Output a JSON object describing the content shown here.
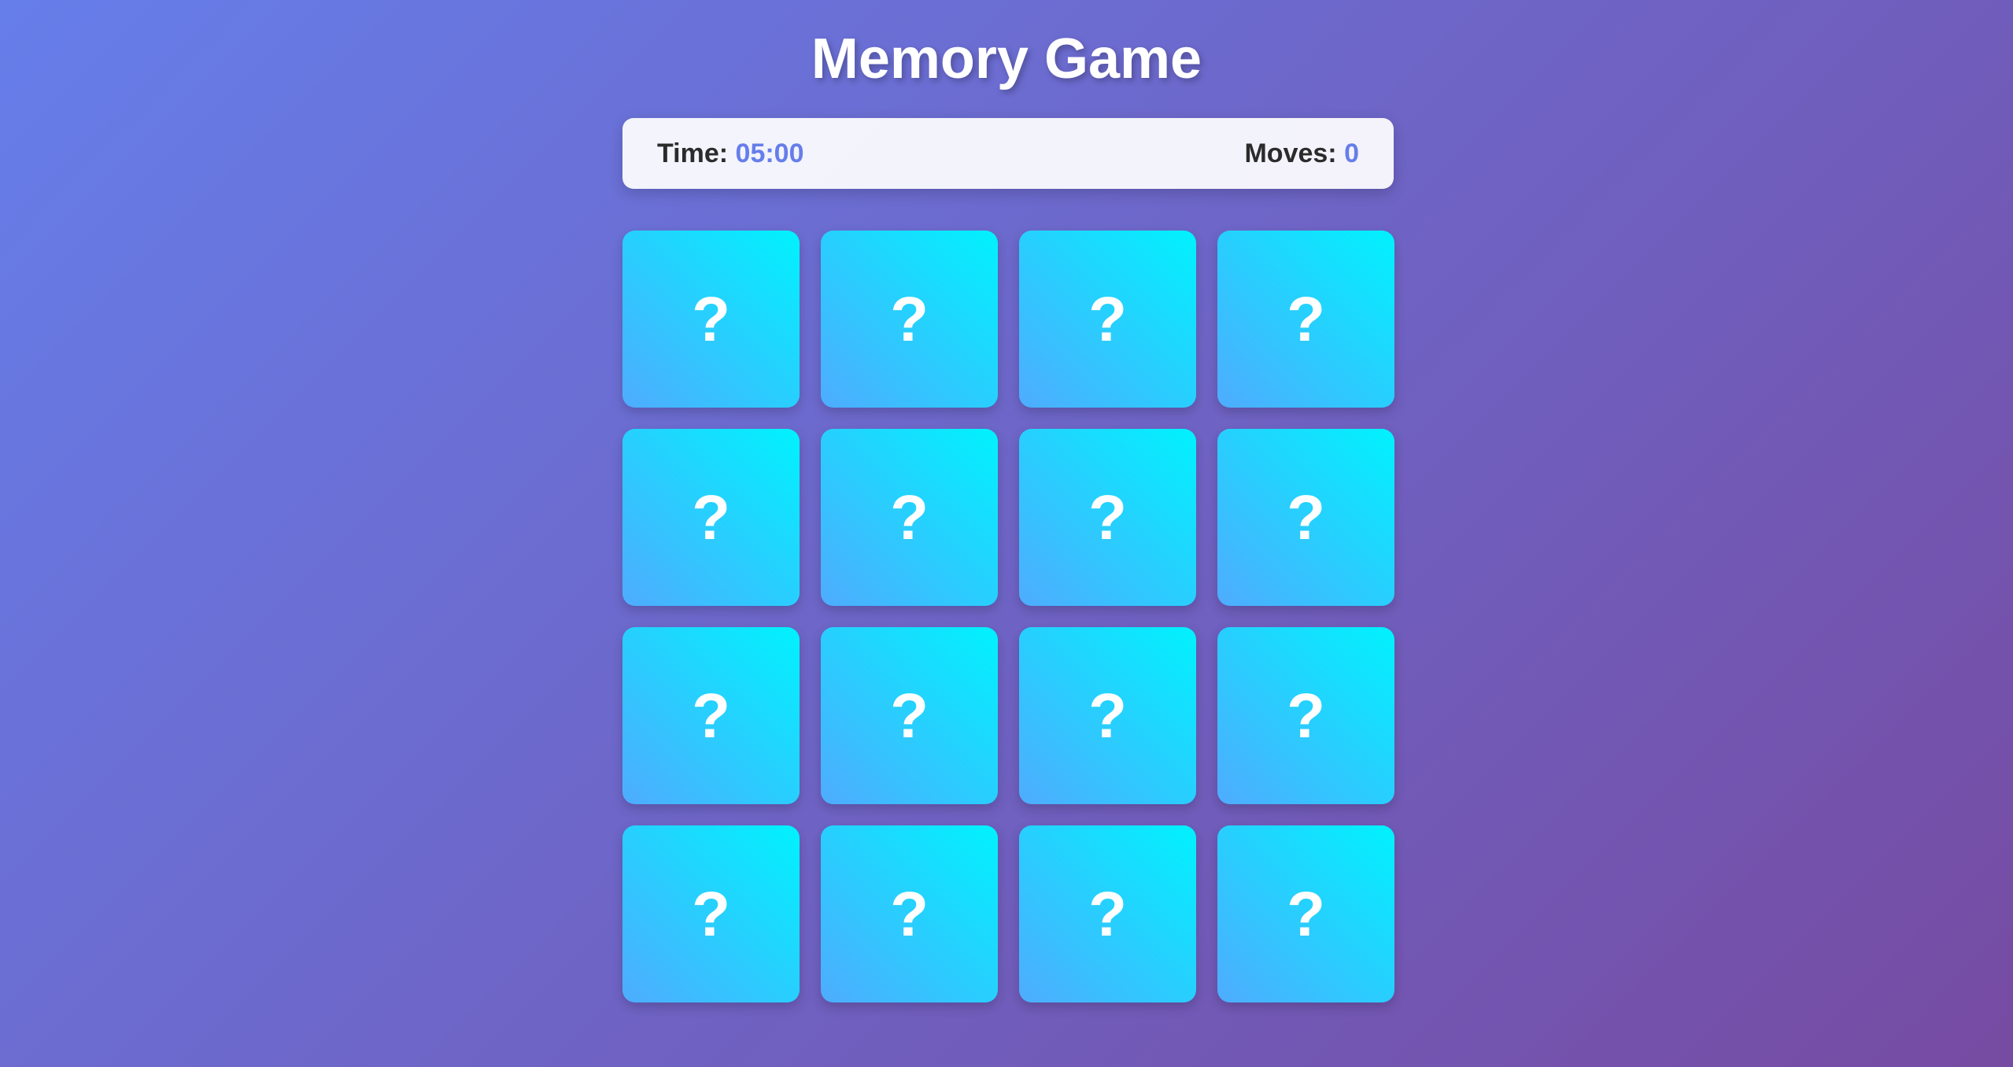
{
  "title": "Memory Game",
  "stats": {
    "time_label": "Time:",
    "time_value": "05:00",
    "moves_label": "Moves:",
    "moves_value": "0"
  },
  "board": {
    "rows": 4,
    "columns": 4,
    "cards": [
      {
        "face": "?"
      },
      {
        "face": "?"
      },
      {
        "face": "?"
      },
      {
        "face": "?"
      },
      {
        "face": "?"
      },
      {
        "face": "?"
      },
      {
        "face": "?"
      },
      {
        "face": "?"
      },
      {
        "face": "?"
      },
      {
        "face": "?"
      },
      {
        "face": "?"
      },
      {
        "face": "?"
      },
      {
        "face": "?"
      },
      {
        "face": "?"
      },
      {
        "face": "?"
      },
      {
        "face": "?"
      }
    ]
  },
  "colors": {
    "background_start": "#667eea",
    "background_end": "#764ba2",
    "card_start": "#4facfe",
    "card_end": "#00f2fe",
    "stat_value": "#667eea"
  }
}
